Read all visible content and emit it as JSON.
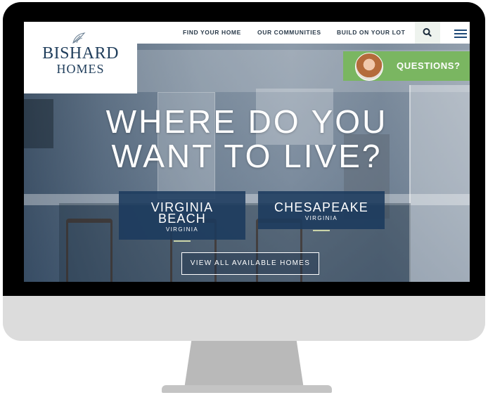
{
  "brand": {
    "logo_line1": "BISHARD",
    "logo_line2": "HOMES",
    "primary_color": "#1f3d5b",
    "accent_green": "#7ab661"
  },
  "nav": {
    "links": [
      "FIND YOUR HOME",
      "OUR COMMUNITIES",
      "BUILD ON YOUR LOT"
    ],
    "search_icon": "search-icon",
    "menu_icon": "hamburger-menu-icon"
  },
  "questions": {
    "label": "QUESTIONS?"
  },
  "hero": {
    "headline_line1": "WHERE DO YOU",
    "headline_line2": "WANT TO LIVE?",
    "locations": [
      {
        "name_line1": "VIRGINIA",
        "name_line2": "BEACH",
        "state": "VIRGINIA"
      },
      {
        "name_line1": "CHESAPEAKE",
        "state": "VIRGINIA"
      }
    ],
    "cta_label": "VIEW ALL AVAILABLE HOMES"
  }
}
